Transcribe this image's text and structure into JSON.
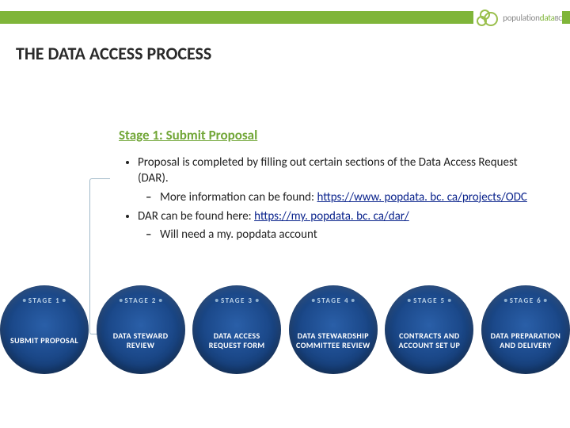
{
  "logo": {
    "text_grey": "population",
    "text_green": "data",
    "suffix_grey": "BC"
  },
  "title": "THE DATA ACCESS PROCESS",
  "stage_heading": "Stage 1: Submit Proposal",
  "bullets": {
    "b1": "Proposal is completed by filling out certain sections of the Data Access Request (DAR).",
    "b1_sub_prefix": "More information can be found: ",
    "b1_link": "https://www. popdata. bc. ca/projects/ODC",
    "b2_prefix": "DAR can be found here: ",
    "b2_link": "https://my. popdata. bc. ca/dar/",
    "b2_sub": "Will need a my. popdata account"
  },
  "stages": [
    {
      "tag": "STAGE 1",
      "label": "SUBMIT PROPOSAL"
    },
    {
      "tag": "STAGE 2",
      "label": "DATA STEWARD REVIEW"
    },
    {
      "tag": "STAGE 3",
      "label": "DATA ACCESS REQUEST FORM"
    },
    {
      "tag": "STAGE 4",
      "label": "DATA STEWARDSHIP COMMITTEE REVIEW"
    },
    {
      "tag": "STAGE 5",
      "label": "CONTRACTS AND ACCOUNT SET UP"
    },
    {
      "tag": "STAGE 6",
      "label": "DATA PREPARATION AND DELIVERY"
    }
  ]
}
